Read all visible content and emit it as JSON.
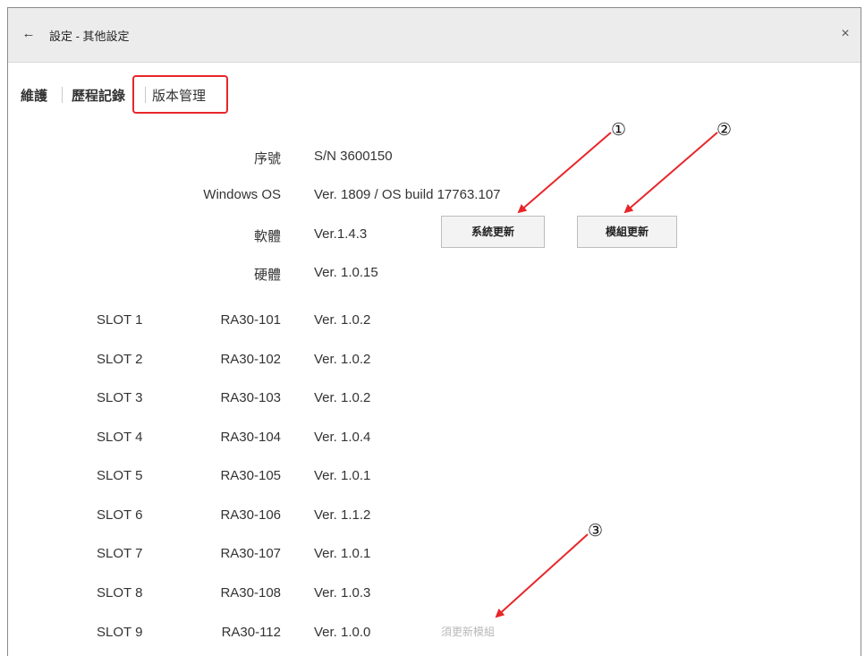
{
  "header": {
    "title": "設定 - 其他設定",
    "back_icon": "arrow-left-icon",
    "close_icon": "close-icon"
  },
  "tabs": [
    {
      "label": "維護"
    },
    {
      "label": "歷程記錄"
    },
    {
      "label": "版本管理"
    }
  ],
  "info": {
    "serial_label": "序號",
    "serial_value": "S/N 3600150",
    "os_label": "Windows OS",
    "os_value": "Ver. 1809 / OS build 17763.107",
    "software_label": "軟體",
    "software_value": "Ver.1.4.3",
    "hardware_label": "硬體",
    "hardware_value": "Ver. 1.0.15"
  },
  "buttons": {
    "system_update": "系統更新",
    "module_update": "模組更新"
  },
  "slots": [
    {
      "slot": "SLOT 1",
      "model": "RA30-101",
      "version": "Ver. 1.0.2"
    },
    {
      "slot": "SLOT 2",
      "model": "RA30-102",
      "version": "Ver. 1.0.2"
    },
    {
      "slot": "SLOT 3",
      "model": "RA30-103",
      "version": "Ver. 1.0.2"
    },
    {
      "slot": "SLOT 4",
      "model": "RA30-104",
      "version": "Ver. 1.0.4"
    },
    {
      "slot": "SLOT 5",
      "model": "RA30-105",
      "version": "Ver. 1.0.1"
    },
    {
      "slot": "SLOT 6",
      "model": "RA30-106",
      "version": "Ver. 1.1.2"
    },
    {
      "slot": "SLOT 7",
      "model": "RA30-107",
      "version": "Ver. 1.0.1"
    },
    {
      "slot": "SLOT 8",
      "model": "RA30-108",
      "version": "Ver. 1.0.3"
    },
    {
      "slot": "SLOT 9",
      "model": "RA30-112",
      "version": "Ver. 1.0.0",
      "status": "須更新模組"
    }
  ],
  "annotations": {
    "marker1": "①",
    "marker2": "②",
    "marker3": "③"
  },
  "colors": {
    "highlight": "#e8262a",
    "arrow": "#e8262a"
  }
}
